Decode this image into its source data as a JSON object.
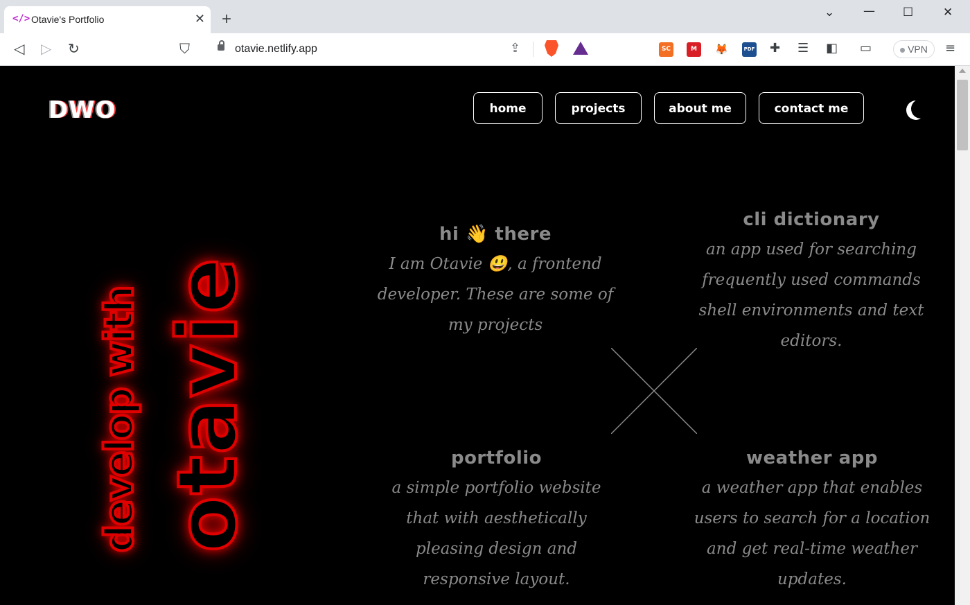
{
  "browser": {
    "tab_title": "Otavie's Portfolio",
    "tab_favicon": "</>",
    "url": "otavie.netlify.app",
    "vpn_label": "VPN",
    "extensions": [
      {
        "name": "soundcloud-ext-icon",
        "label": "SC",
        "color": "#f26f23"
      },
      {
        "name": "mendeley-ext-icon",
        "label": "M",
        "color": "#d81f26"
      },
      {
        "name": "metamask-ext-icon",
        "label": "🦊",
        "color": "#ffffff"
      },
      {
        "name": "pdf-ext-icon",
        "label": "PDF",
        "color": "#1d4f91"
      }
    ]
  },
  "site": {
    "logo": "DWO",
    "nav": [
      {
        "label": "home"
      },
      {
        "label": "projects"
      },
      {
        "label": "about me"
      },
      {
        "label": "contact me"
      }
    ],
    "vertical_small": "develop with",
    "vertical_big": "otavie",
    "intro": {
      "title": "hi 👋 there",
      "text": "I am Otavie 😃, a frontend developer. These are some of my projects"
    },
    "projects": [
      {
        "title": "cli dictionary",
        "text": "an app used for searching frequently used commands shell environments and text editors."
      },
      {
        "title": "portfolio",
        "text": "a simple portfolio website that with aesthetically pleasing design and responsive layout."
      },
      {
        "title": "weather app",
        "text": "a weather app that enables users to search for a location and get real-time weather updates."
      }
    ]
  },
  "colors": {
    "accent_glow": "#ff0000",
    "text_grey": "#8a8a8a",
    "background": "#000000"
  }
}
